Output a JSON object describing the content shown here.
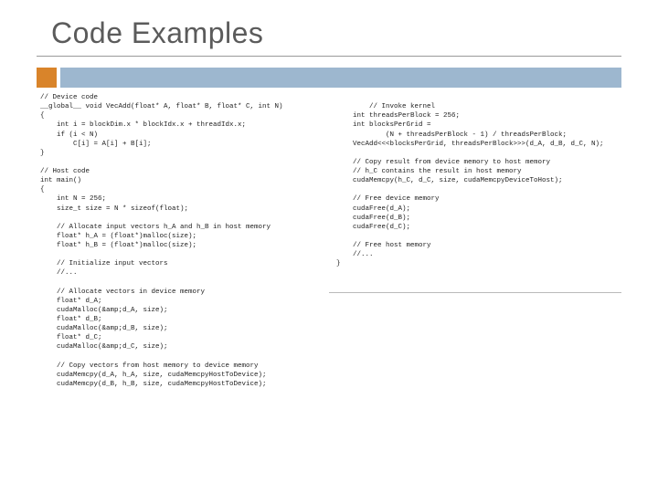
{
  "title": "Code Examples",
  "left_code": "// Device code\n__global__ void VecAdd(float* A, float* B, float* C, int N)\n{\n    int i = blockDim.x * blockIdx.x + threadIdx.x;\n    if (i < N)\n        C[i] = A[i] + B[i];\n}\n\n// Host code\nint main()\n{\n    int N = 256;\n    size_t size = N * sizeof(float);\n\n    // Allocate input vectors h_A and h_B in host memory\n    float* h_A = (float*)malloc(size);\n    float* h_B = (float*)malloc(size);\n\n    // Initialize input vectors\n    //...\n\n    // Allocate vectors in device memory\n    float* d_A;\n    cudaMalloc(&amp;d_A, size);\n    float* d_B;\n    cudaMalloc(&amp;d_B, size);\n    float* d_C;\n    cudaMalloc(&amp;d_C, size);\n\n    // Copy vectors from host memory to device memory\n    cudaMemcpy(d_A, h_A, size, cudaMemcpyHostToDevice);\n    cudaMemcpy(d_B, h_B, size, cudaMemcpyHostToDevice);",
  "right_code": "    // Invoke kernel\n    int threadsPerBlock = 256;\n    int blocksPerGrid =\n            (N + threadsPerBlock - 1) / threadsPerBlock;\n    VecAdd<<<blocksPerGrid, threadsPerBlock>>>(d_A, d_B, d_C, N);\n\n    // Copy result from device memory to host memory\n    // h_C contains the result in host memory\n    cudaMemcpy(h_C, d_C, size, cudaMemcpyDeviceToHost);\n\n    // Free device memory\n    cudaFree(d_A);\n    cudaFree(d_B);\n    cudaFree(d_C);\n\n    // Free host memory\n    //...\n}"
}
